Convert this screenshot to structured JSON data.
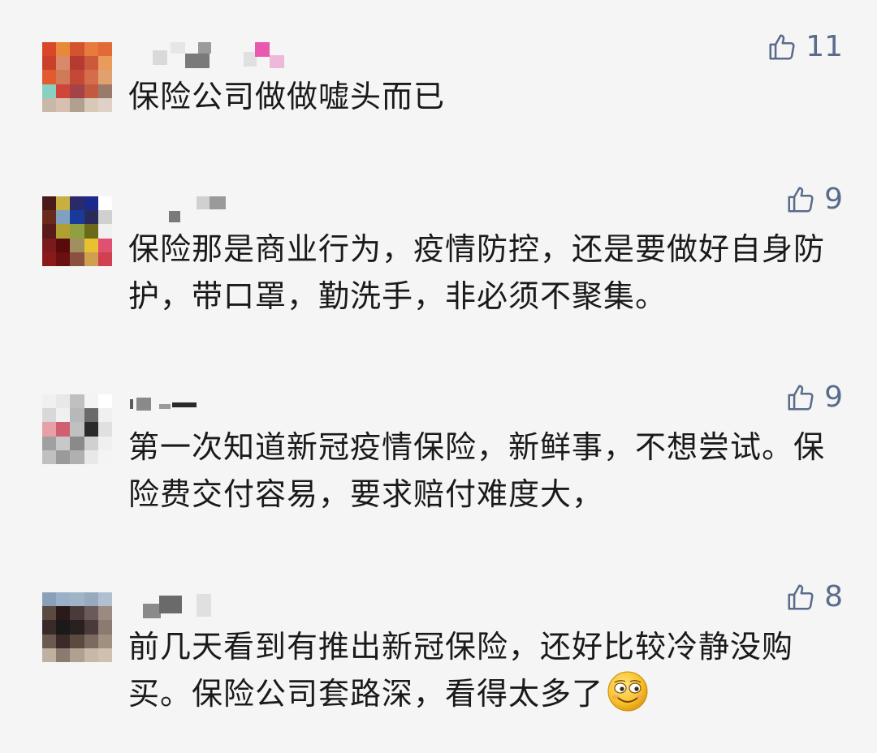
{
  "comments": [
    {
      "text": "保险公司做做嘘头而已",
      "likes": "11",
      "like_icon": "thumbs-up-icon"
    },
    {
      "text": "保险那是商业行为，疫情防控，还是要做好自身防护，带口罩，勤洗手，非必须不聚集。",
      "likes": "9",
      "like_icon": "thumbs-up-icon"
    },
    {
      "text": "第一次知道新冠疫情保险，新鲜事，不想尝试。保险费交付容易，要求赔付难度大，",
      "likes": "9",
      "like_icon": "thumbs-up-icon"
    },
    {
      "text": "前几天看到有推出新冠保险，还好比较冷静没购买。保险公司套路深，看得太多了",
      "likes": "8",
      "like_icon": "thumbs-up-icon",
      "emoji": "grinning-face-emoji"
    }
  ],
  "colors": {
    "background": "#f5f5f5",
    "like_color": "#5a6b8c",
    "text_color": "#1a1a1a"
  }
}
